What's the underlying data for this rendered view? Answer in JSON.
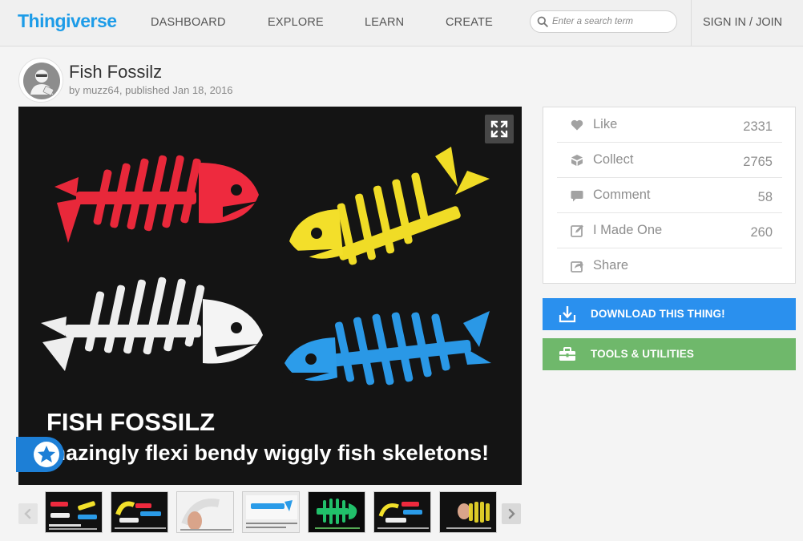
{
  "header": {
    "logo": "Thingiverse",
    "nav": [
      "DASHBOARD",
      "EXPLORE",
      "LEARN",
      "CREATE"
    ],
    "search_placeholder": "Enter a search term",
    "signin": "SIGN IN / JOIN"
  },
  "thing": {
    "title": "Fish Fossilz",
    "byline": "by muzz64, published Jan 18, 2016",
    "caption_line1": "FISH FOSSILZ",
    "caption_line2": "mazingly flexi bendy wiggly fish skeletons!"
  },
  "stats": [
    {
      "label": "Like",
      "count": "2331",
      "icon": "heart-icon"
    },
    {
      "label": "Collect",
      "count": "2765",
      "icon": "collect-icon"
    },
    {
      "label": "Comment",
      "count": "58",
      "icon": "comment-icon"
    },
    {
      "label": "I Made One",
      "count": "260",
      "icon": "made-one-icon"
    },
    {
      "label": "Share",
      "count": "",
      "icon": "share-icon"
    }
  ],
  "actions": {
    "download": "DOWNLOAD THIS THING!",
    "tools": "TOOLS & UTILITIES"
  },
  "colors": {
    "brand": "#1d9ce8",
    "download": "#2a90ee",
    "tools": "#6fb86b",
    "fish_red": "#ee2a3e",
    "fish_yellow": "#f2e02a",
    "fish_white": "#f2f2f2",
    "fish_blue": "#2a9be8"
  }
}
